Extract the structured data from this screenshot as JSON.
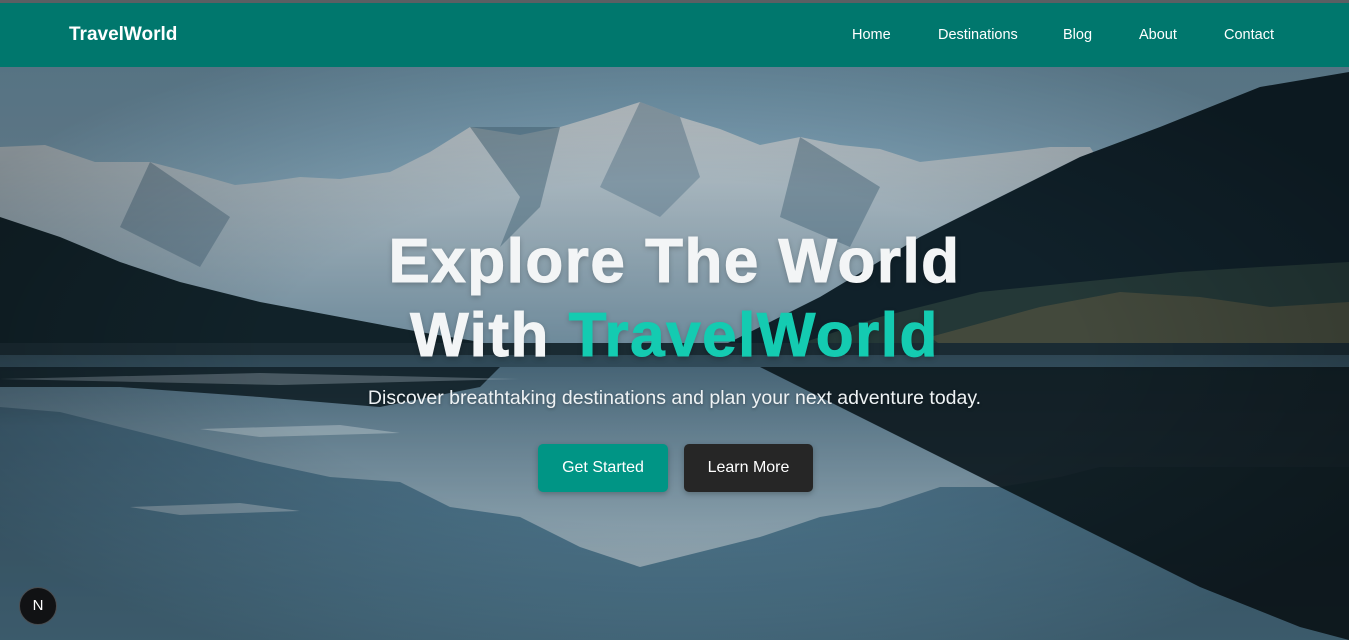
{
  "navbar": {
    "brand": "TravelWorld",
    "links": [
      "Home",
      "Destinations",
      "Blog",
      "About",
      "Contact"
    ],
    "background": "#00776d"
  },
  "hero": {
    "headline_line1": "Explore The World",
    "headline_line2_prefix": "With ",
    "headline_line2_accent": "TravelWorld",
    "subtitle": "Discover breathtaking destinations and plan your next adventure today.",
    "primary_button": "Get Started",
    "secondary_button": "Learn More",
    "accent_color": "#14cbb1",
    "primary_button_color": "#009585",
    "secondary_button_color": "#262626"
  },
  "dev_badge": {
    "icon": "N",
    "icon_name": "nextjs-logo-icon"
  }
}
